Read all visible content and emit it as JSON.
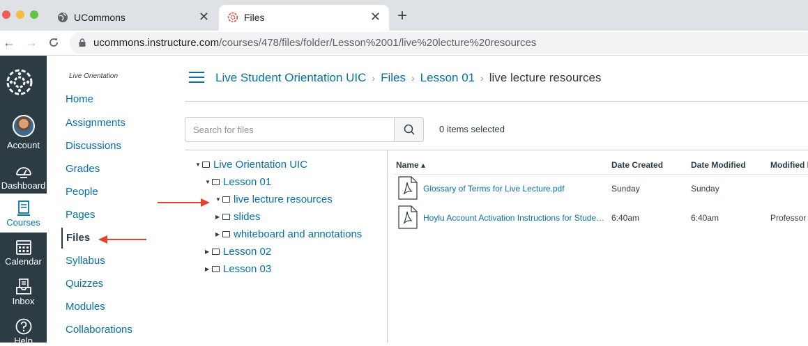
{
  "browser": {
    "tabs": [
      {
        "title": "UCommons",
        "active": false
      },
      {
        "title": "Files",
        "active": true
      }
    ],
    "new_tab": "+",
    "close_glyph": "✕",
    "url_host": "ucommons.instructure.com",
    "url_path": "/courses/478/files/folder/Lesson%2001/live%20lecture%20resources"
  },
  "global_nav": {
    "items": [
      {
        "label": "Account",
        "icon": "avatar"
      },
      {
        "label": "Dashboard",
        "icon": "dashboard-icon"
      },
      {
        "label": "Courses",
        "icon": "courses-icon",
        "active": true
      },
      {
        "label": "Calendar",
        "icon": "calendar-icon"
      },
      {
        "label": "Inbox",
        "icon": "inbox-icon"
      },
      {
        "label": "Help",
        "icon": "help-icon"
      }
    ]
  },
  "course_nav": {
    "term": "Live Orientation",
    "items": [
      "Home",
      "Assignments",
      "Discussions",
      "Grades",
      "People",
      "Pages",
      "Files",
      "Syllabus",
      "Quizzes",
      "Modules",
      "Collaborations"
    ],
    "current": "Files"
  },
  "breadcrumbs": [
    "Live Student Orientation UIC",
    "Files",
    "Lesson 01",
    "live lecture resources"
  ],
  "search": {
    "placeholder": "Search for files"
  },
  "selection": "0 items selected",
  "tree": [
    {
      "label": "Live Orientation UIC",
      "expanded": true
    },
    {
      "label": "Lesson 01",
      "expanded": true
    },
    {
      "label": "live lecture resources",
      "expanded": true
    },
    {
      "label": "slides",
      "expanded": false
    },
    {
      "label": "whiteboard and annotations",
      "expanded": false
    },
    {
      "label": "Lesson 02",
      "expanded": false
    },
    {
      "label": "Lesson 03",
      "expanded": false
    }
  ],
  "table": {
    "columns": [
      "Name ▴",
      "Date Created",
      "Date Modified",
      "Modified By"
    ],
    "rows": [
      {
        "name": "Glossary of Terms for Live Lecture.pdf",
        "created": "Sunday",
        "modified": "Sunday",
        "modified_by": ""
      },
      {
        "name": "Hoylu Account Activation Instructions for Stude…",
        "created": "6:40am",
        "modified": "6:40am",
        "modified_by": "Professor"
      }
    ]
  },
  "colors": {
    "link": "#0770a3",
    "nav_bg": "#2d3b45",
    "arrow": "#e0442f"
  }
}
